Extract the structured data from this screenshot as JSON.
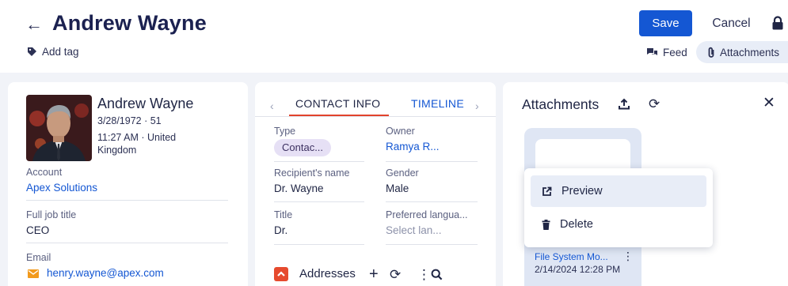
{
  "header": {
    "title": "Andrew Wayne",
    "add_tag": "Add tag",
    "save": "Save",
    "cancel": "Cancel",
    "feed": "Feed",
    "attachments": "Attachments",
    "accent": "#1457d3"
  },
  "contact": {
    "name": "Andrew Wayne",
    "dob": "3/28/1972 · 51",
    "local_time": "11:27 AM · United",
    "country": "Kingdom",
    "account_label": "Account",
    "account": "Apex Solutions",
    "job_title_label": "Full job title",
    "job_title": "CEO",
    "email_label": "Email",
    "email": "henry.wayne@apex.com"
  },
  "contact_info": {
    "tabs": [
      {
        "label": "CONTACT INFO",
        "active": true
      },
      {
        "label": "TIMELINE",
        "active": false
      }
    ],
    "fields": {
      "type_label": "Type",
      "type": "Contac...",
      "owner_label": "Owner",
      "owner": "Ramya R...",
      "recipient_label": "Recipient's name",
      "recipient": "Dr. Wayne",
      "gender_label": "Gender",
      "gender": "Male",
      "title_label": "Title",
      "title": "Dr.",
      "language_label": "Preferred langua...",
      "language_placeholder": "Select lan..."
    },
    "addresses_label": "Addresses"
  },
  "attachments_panel": {
    "title": "Attachments",
    "file": {
      "name": "File System Mo...",
      "date": "2/14/2024 12:28 PM"
    },
    "menu": {
      "preview": "Preview",
      "delete": "Delete"
    }
  }
}
